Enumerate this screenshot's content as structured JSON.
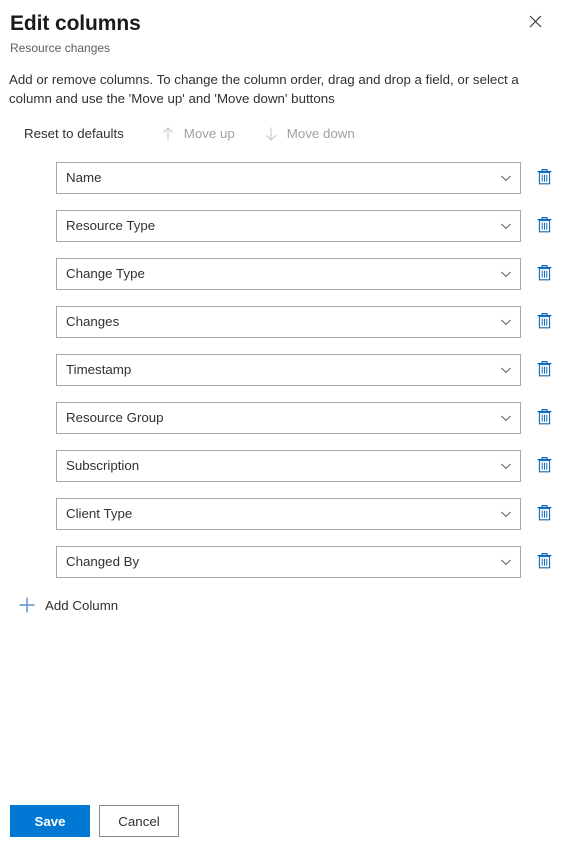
{
  "panel": {
    "title": "Edit columns",
    "subtitle": "Resource changes",
    "close_icon": "close-icon",
    "description": "Add or remove columns. To change the column order, drag and drop a field, or select a column and use the 'Move up' and 'Move down' buttons"
  },
  "command_bar": {
    "reset": {
      "label": "Reset to defaults",
      "disabled": false
    },
    "move_up": {
      "label": "Move up",
      "icon": "arrow-up-icon",
      "disabled": true
    },
    "move_down": {
      "label": "Move down",
      "icon": "arrow-down-icon",
      "disabled": true
    }
  },
  "columns": [
    {
      "label": "Name",
      "chevron_icon": "chevron-down-icon",
      "delete_icon": "trash-icon"
    },
    {
      "label": "Resource Type",
      "chevron_icon": "chevron-down-icon",
      "delete_icon": "trash-icon"
    },
    {
      "label": "Change Type",
      "chevron_icon": "chevron-down-icon",
      "delete_icon": "trash-icon"
    },
    {
      "label": "Changes",
      "chevron_icon": "chevron-down-icon",
      "delete_icon": "trash-icon"
    },
    {
      "label": "Timestamp",
      "chevron_icon": "chevron-down-icon",
      "delete_icon": "trash-icon"
    },
    {
      "label": "Resource Group",
      "chevron_icon": "chevron-down-icon",
      "delete_icon": "trash-icon"
    },
    {
      "label": "Subscription",
      "chevron_icon": "chevron-down-icon",
      "delete_icon": "trash-icon"
    },
    {
      "label": "Client Type",
      "chevron_icon": "chevron-down-icon",
      "delete_icon": "trash-icon"
    },
    {
      "label": "Changed By",
      "chevron_icon": "chevron-down-icon",
      "delete_icon": "trash-icon"
    }
  ],
  "add_column": {
    "label": "Add Column",
    "icon": "plus-icon"
  },
  "footer": {
    "save_label": "Save",
    "cancel_label": "Cancel"
  },
  "colors": {
    "accent": "#0078d4",
    "trash_blue": "#0f6cbd",
    "plus_blue": "#6f9fd8",
    "text": "#323130",
    "subtle_text": "#605e5c",
    "disabled_text": "#a19f9d",
    "border": "#a6a6a6"
  }
}
